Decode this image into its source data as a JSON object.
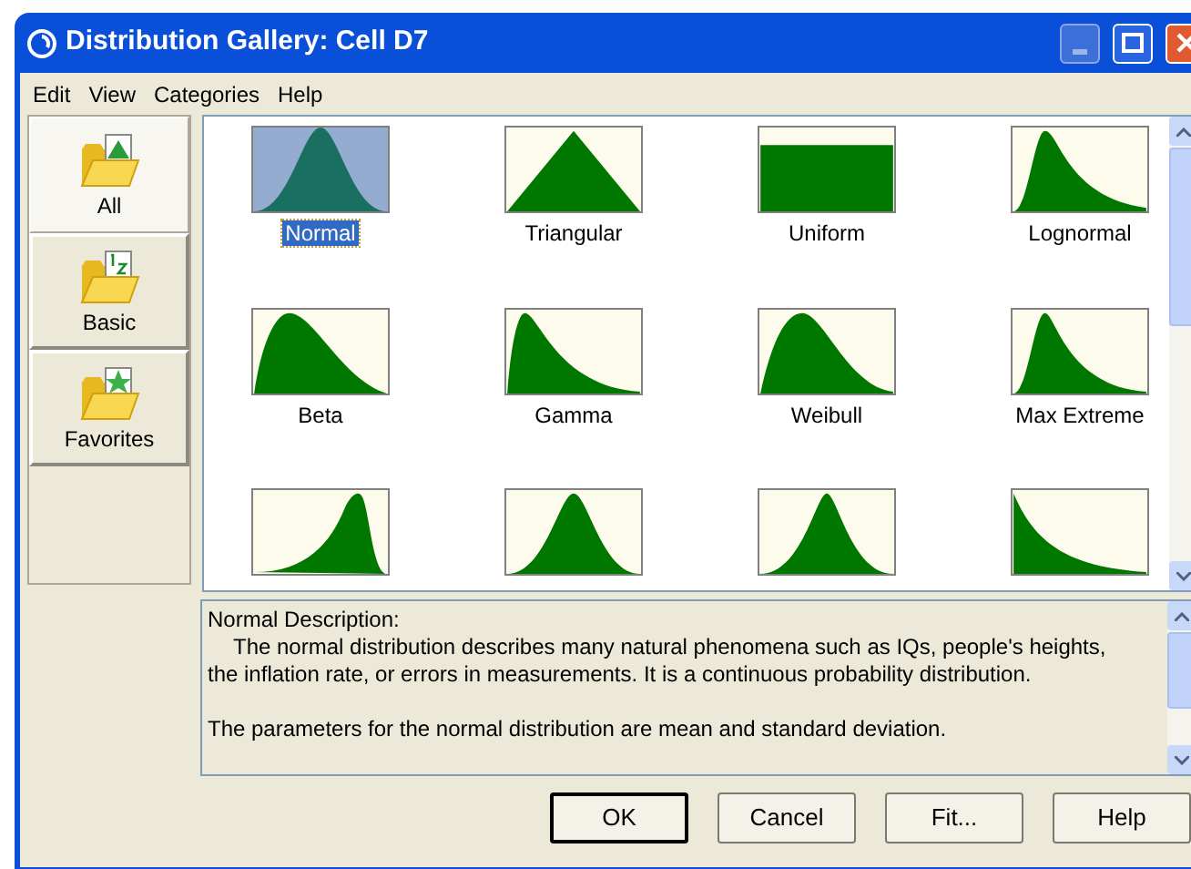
{
  "window": {
    "title": "Distribution Gallery: Cell D7"
  },
  "menu": [
    "Edit",
    "View",
    "Categories",
    "Help"
  ],
  "categories": [
    {
      "label": "All",
      "selected": true,
      "kind": "chart"
    },
    {
      "label": "Basic",
      "selected": false,
      "kind": "numbers"
    },
    {
      "label": "Favorites",
      "selected": false,
      "kind": "star"
    }
  ],
  "gallery": [
    {
      "label": "Normal",
      "kind": "normal",
      "selected": true
    },
    {
      "label": "Triangular",
      "kind": "triangular",
      "selected": false
    },
    {
      "label": "Uniform",
      "kind": "uniform",
      "selected": false
    },
    {
      "label": "Lognormal",
      "kind": "lognormal",
      "selected": false
    },
    {
      "label": "Beta",
      "kind": "beta",
      "selected": false
    },
    {
      "label": "Gamma",
      "kind": "gamma",
      "selected": false
    },
    {
      "label": "Weibull",
      "kind": "weibull",
      "selected": false
    },
    {
      "label": "Max Extreme",
      "kind": "maxextreme",
      "selected": false
    },
    {
      "kind": "minextreme",
      "selected": false
    },
    {
      "kind": "logistic",
      "selected": false
    },
    {
      "kind": "student",
      "selected": false
    },
    {
      "kind": "exponential",
      "selected": false
    }
  ],
  "description": {
    "heading": "Normal Description:",
    "paragraphs": [
      "The normal distribution describes many natural phenomena such as IQs, people's heights, the inflation rate, or errors in measurements. It is a continuous probability distribution.",
      "The parameters for the normal distribution are mean and standard deviation."
    ]
  },
  "buttons": [
    {
      "label": "OK",
      "default": true
    },
    {
      "label": "Cancel",
      "default": false
    },
    {
      "label": "Fit...",
      "default": false
    },
    {
      "label": "Help",
      "default": false
    }
  ]
}
